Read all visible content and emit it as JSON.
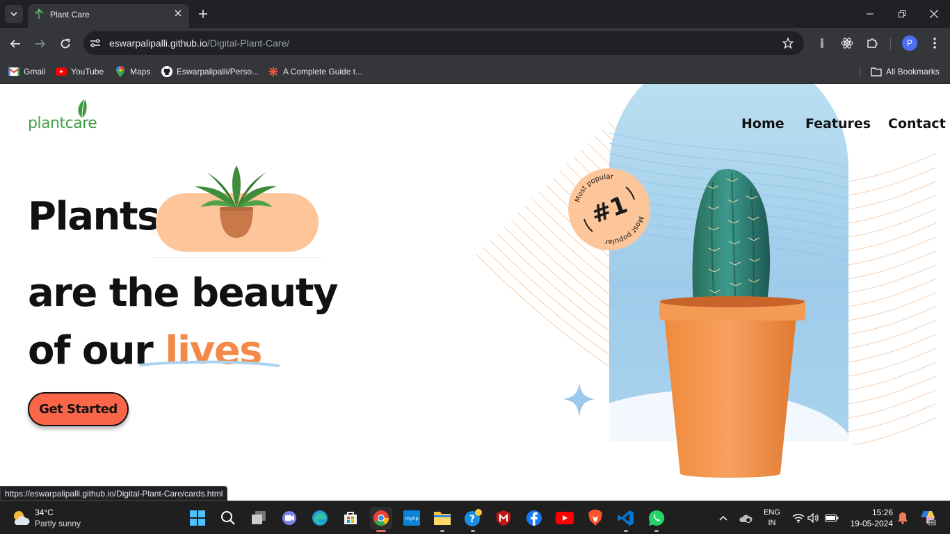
{
  "browser": {
    "tab_title": "Plant Care",
    "url_host": "eswarpalipalli.github.io",
    "url_path": "/Digital-Plant-Care/",
    "profile_initial": "P",
    "bookmarks": [
      {
        "label": "Gmail",
        "icon": "gmail-icon"
      },
      {
        "label": "YouTube",
        "icon": "youtube-icon"
      },
      {
        "label": "Maps",
        "icon": "maps-icon"
      },
      {
        "label": "Eswarpalipalli/Perso...",
        "icon": "github-icon"
      },
      {
        "label": "A Complete Guide t...",
        "icon": "asterisk-icon"
      }
    ],
    "all_bookmarks": "All Bookmarks",
    "status_url": "https://eswarpalipalli.github.io/Digital-Plant-Care/cards.html"
  },
  "page": {
    "logo": {
      "plant": "plant",
      "care": "care"
    },
    "nav": [
      "Home",
      "Features",
      "Contact"
    ],
    "hero": {
      "line1": "Plants",
      "line2": "are the beauty",
      "line3_prefix": "of our ",
      "line3_highlight": "lives"
    },
    "cta": "Get Started",
    "badge": {
      "rank": "#1",
      "ring_text": "Most popular"
    }
  },
  "taskbar": {
    "weather_temp": "34°C",
    "weather_condition": "Partly sunny",
    "lang_top": "ENG",
    "lang_bottom": "IN",
    "time": "15:26",
    "date": "19-05-2024"
  },
  "colors": {
    "accent_orange": "#f4894a",
    "cta_red": "#fb6649",
    "pill_peach": "#fdc59a",
    "logo_green": "#4aa34a"
  }
}
